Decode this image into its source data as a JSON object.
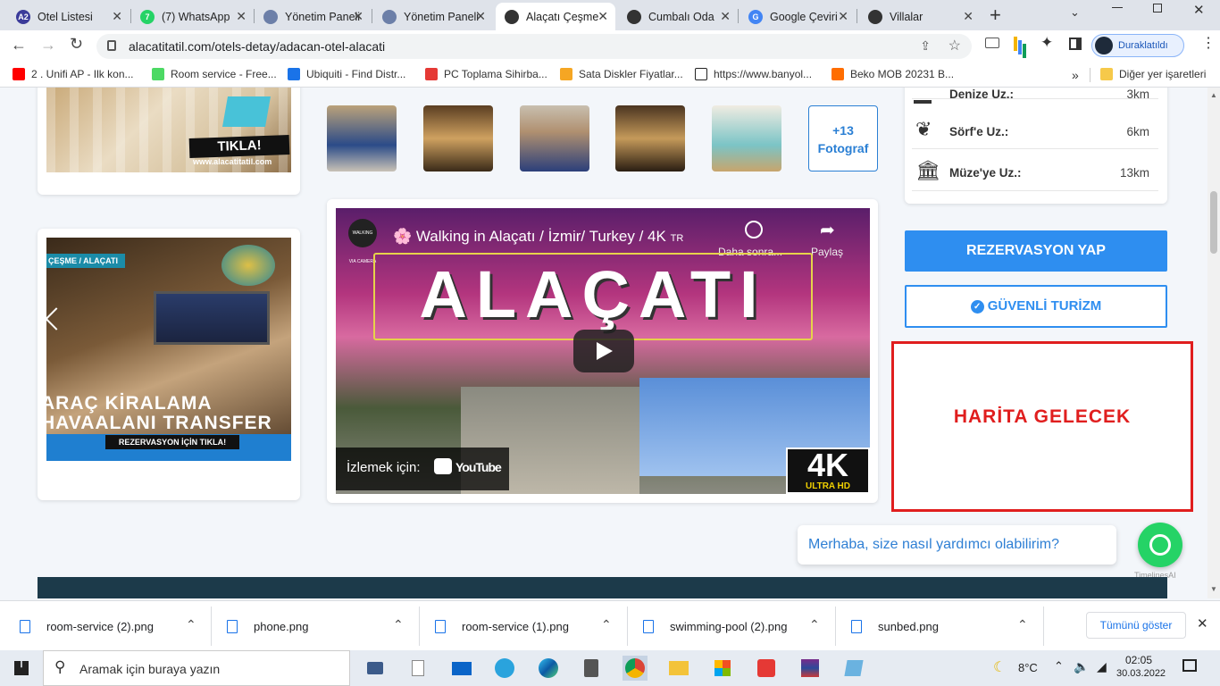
{
  "tabs": [
    {
      "title": "Otel Listesi",
      "icon_color": "#3b3b9a",
      "icon_text": "A2"
    },
    {
      "title": "(7) WhatsApp",
      "icon_color": "#25d366",
      "icon_text": "7"
    },
    {
      "title": "Yönetim Paneli",
      "icon_color": "#6c7fa8",
      "icon_text": ""
    },
    {
      "title": "Yönetim Paneli",
      "icon_color": "#6c7fa8",
      "icon_text": ""
    },
    {
      "title": "Alaçatı Çeşme",
      "icon_color": "#333",
      "icon_text": ""
    },
    {
      "title": "Cumbalı Oda",
      "icon_color": "#333",
      "icon_text": ""
    },
    {
      "title": "Google Çeviri",
      "icon_color": "#4285f4",
      "icon_text": "G"
    },
    {
      "title": "Villalar",
      "icon_color": "#333",
      "icon_text": ""
    }
  ],
  "new_tab_label": "+",
  "address": {
    "url": "alacatitatil.com/otels-detay/adacan-otel-alacati"
  },
  "profile_label": "Duraklatıldı",
  "bookmarks": [
    {
      "label": "2 . Unifi AP - Ilk kon...",
      "color": "#ff0000"
    },
    {
      "label": "Room service - Free...",
      "color": "#4cd964"
    },
    {
      "label": "Ubiquiti - Find Distr...",
      "color": "#1a73e8"
    },
    {
      "label": "PC Toplama Sihirba...",
      "color": "#e53935"
    },
    {
      "label": "Sata Diskler Fiyatlar...",
      "color": "#f5a623"
    },
    {
      "label": "https://www.banyol...",
      "color": "#222"
    },
    {
      "label": "Beko MOB 20231 B...",
      "color": "#ff6d00"
    }
  ],
  "bookmarks_more": "»",
  "other_bookmarks": "Diğer yer işaretleri",
  "left_ads": {
    "ad1_button": "TIKLA!",
    "ad1_url": "www.alacatitatil.com",
    "ad2_tag": "ÇEŞME / ALAÇATI",
    "ad2_line1": "ARAÇ KİRALAMA",
    "ad2_line2": "HAVAALANI TRANSFER",
    "ad2_cta": "REZERVASYON İÇİN TIKLA!"
  },
  "gallery": {
    "more_count": "+13",
    "more_label": "Fotograf"
  },
  "video": {
    "channel": "WALKING VIA CAMERA",
    "title": "🌸 Walking in Alaçatı / İzmir/ Turkey / 4K",
    "title_suffix": "TR",
    "watch_later": "Daha sonra...",
    "share": "Paylaş",
    "overlay_text": "ALAÇATI",
    "watch_on": "İzlemek için:",
    "youtube": "YouTube",
    "badge_4k": "4K",
    "badge_uhd": "ULTRA HD"
  },
  "distances": [
    {
      "label": "Denize Uz.:",
      "value": "3km"
    },
    {
      "label": "Sörf'e Uz.:",
      "value": "6km"
    },
    {
      "label": "Müze'ye Uz.:",
      "value": "13km"
    }
  ],
  "reservation_button": "REZERVASYON YAP",
  "secure_button": "GÜVENLİ TURİZM",
  "map_placeholder": "HARİTA GELECEK",
  "chat_bubble": "Merhaba, size nasıl yardımcı olabilirim?",
  "chat_credit": "TimelinesAI",
  "downloads": [
    {
      "file": "room-service (2).png"
    },
    {
      "file": "phone.png"
    },
    {
      "file": "room-service (1).png"
    },
    {
      "file": "swimming-pool (2).png"
    },
    {
      "file": "sunbed.png"
    }
  ],
  "show_all": "Tümünü göster",
  "taskbar": {
    "search_placeholder": "Aramak için buraya yazın",
    "weather": "8°C",
    "time": "02:05",
    "date": "30.03.2022"
  }
}
